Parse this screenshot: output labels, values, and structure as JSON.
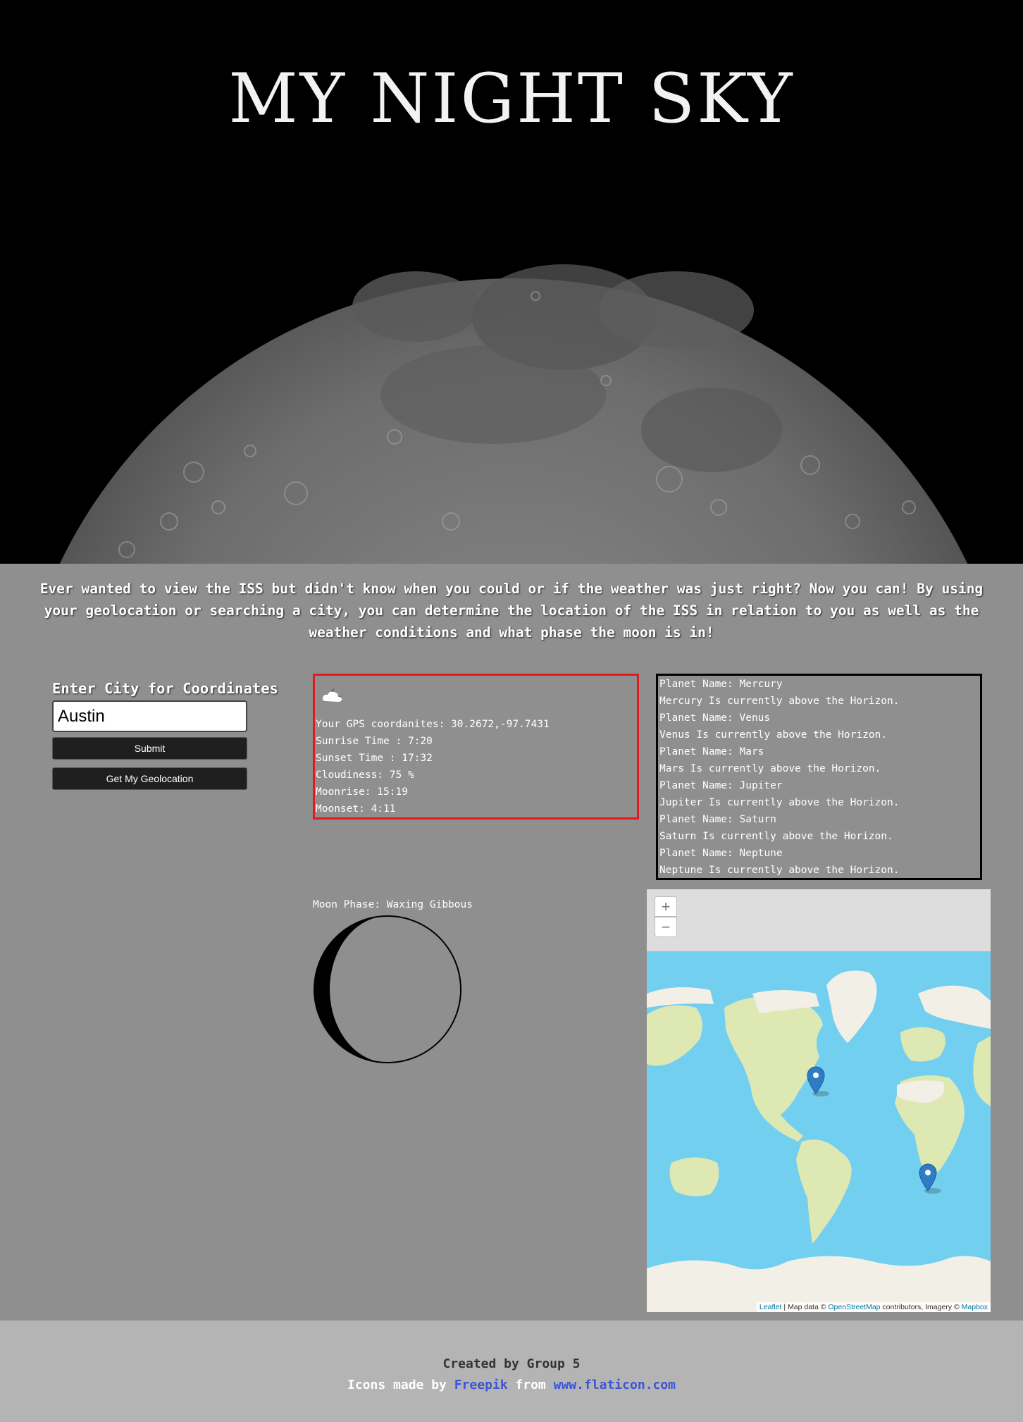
{
  "site": {
    "title": "MY NIGHT SKY",
    "intro": "Ever wanted to view the ISS but didn't know when you could or if the weather was just right? Now you can! By using your geolocation or searching a city, you can determine the location of the ISS in relation to you as well as the weather conditions and what phase the moon is in!"
  },
  "search": {
    "label": "Enter City for Coordinates",
    "value": "Austin",
    "submit_label": "Submit",
    "geolocation_label": "Get My Geolocation"
  },
  "weather": {
    "icon": "partly-cloudy-night-icon",
    "lines": [
      "Your GPS coordanites: 30.2672,-97.7431",
      "Sunrise Time : 7:20",
      "Sunset Time : 17:32",
      "Cloudiness: 75 %",
      "Moonrise: 15:19",
      "Moonset: 4:11"
    ]
  },
  "planets": [
    "Planet Name: Mercury",
    "Mercury Is currently above the Horizon.",
    "Planet Name: Venus",
    "Venus Is currently above the Horizon.",
    "Planet Name: Mars",
    "Mars Is currently above the Horizon.",
    "Planet Name: Jupiter",
    "Jupiter Is currently above the Horizon.",
    "Planet Name: Saturn",
    "Saturn Is currently above the Horizon.",
    "Planet Name: Neptune",
    "Neptune Is currently above the Horizon."
  ],
  "moon": {
    "phase_label": "Moon Phase: Waxing Gibbous"
  },
  "map": {
    "zoom_in": "+",
    "zoom_out": "−",
    "attribution": {
      "leaflet": "Leaflet",
      "sep": " | Map data © ",
      "osm": "OpenStreetMap",
      "mid": " contributors, Imagery © ",
      "mapbox": "Mapbox"
    },
    "colors": {
      "ocean": "#73cfef",
      "land": "#f2efe6",
      "vegetation": "#dde8b2",
      "marker": "#2e7dc4"
    }
  },
  "footer": {
    "credit": "Created by Group 5",
    "icons_prefix": "Icons made by ",
    "freepik": "Freepik",
    "from": " from ",
    "flaticon": "www.flaticon.com"
  }
}
